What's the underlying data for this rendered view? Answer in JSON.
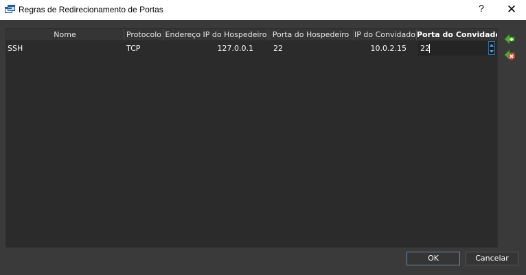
{
  "window": {
    "title": "Regras de Redirecionamento de Portas",
    "help_label": "?",
    "close_label": "✕"
  },
  "table": {
    "columns": [
      "Nome",
      "Protocolo",
      "Endereço IP do Hospedeiro",
      "Porta do Hospedeiro",
      "IP do Convidado",
      "Porta do Convidado"
    ],
    "rows": [
      {
        "nome": "SSH",
        "protocolo": "TCP",
        "ip_hospedeiro": "127.0.0.1",
        "porta_hospedeiro": "22",
        "ip_convidado": "10.0.2.15",
        "porta_convidado": "22"
      }
    ]
  },
  "side_actions": {
    "add_icon": "add-rule-icon",
    "remove_icon": "remove-rule-icon"
  },
  "buttons": {
    "ok": "OK",
    "cancel": "Cancelar"
  },
  "colors": {
    "background": "#3a3a3a",
    "table_bg": "#2b2b2b",
    "focus_border": "#6d8aa5",
    "add_green": "#4caf2a",
    "remove_red": "#e0453b"
  }
}
